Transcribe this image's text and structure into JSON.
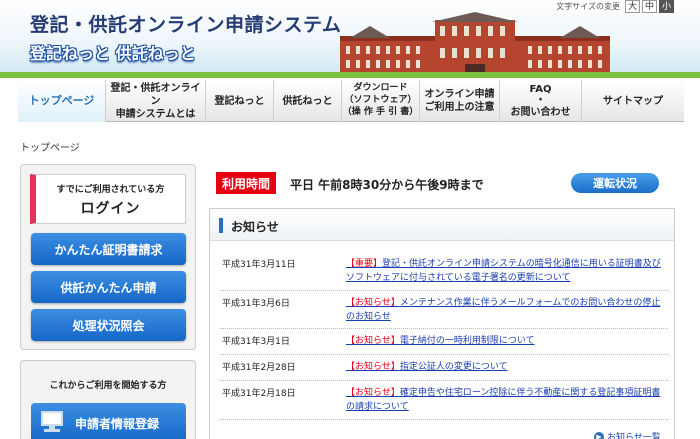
{
  "header": {
    "title": "登記・供託オンライン申請システム",
    "subtitle": "登記ねっと 供託ねっと",
    "font_size_label": "文字サイズの変更",
    "font_sizes": [
      "大",
      "中",
      "小"
    ]
  },
  "nav": {
    "items": [
      {
        "label": "トップページ",
        "width": 88
      },
      {
        "label": "登記・供託オンライン\n申請システムとは",
        "width": 100
      },
      {
        "label": "登記ねっと",
        "width": 68
      },
      {
        "label": "供託ねっと",
        "width": 68
      },
      {
        "label": "ダウンロード\n（ソフトウェア）\n（操 作 手 引 書）",
        "width": 78
      },
      {
        "label": "オンライン申請\nご利用上の注意",
        "width": 80
      },
      {
        "label": "FAQ\n・\nお問い合わせ",
        "width": 82
      },
      {
        "label": "サイトマップ",
        "width": 102
      }
    ]
  },
  "breadcrumb": "トップページ",
  "sidebar": {
    "login_sub": "すでにご利用されている方",
    "login_main": "ログイン",
    "buttons": [
      "かんたん証明書請求",
      "供託かんたん申請",
      "処理状況照会"
    ],
    "start_sub": "これからご利用を開始する方",
    "register_label": "申請者情報登録"
  },
  "hours": {
    "label": "利用時間",
    "text": "平日 午前8時30分から午後9時まで",
    "status_button": "運転状況"
  },
  "news": {
    "title": "お知らせ",
    "items": [
      {
        "date": "平成31年3月11日",
        "tag": "【重要】",
        "text": "登記・供託オンライン申請システムの暗号化通信に用いる証明書及びソフトウェアに付与されている電子署名の更新について"
      },
      {
        "date": "平成31年3月6日",
        "tag": "【お知らせ】",
        "text": "メンテナンス作業に伴うメールフォームでのお問い合わせの停止のお知らせ"
      },
      {
        "date": "平成31年3月1日",
        "tag": "【お知らせ】",
        "text": "電子納付の一時利用制限について"
      },
      {
        "date": "平成31年2月28日",
        "tag": "【お知らせ】",
        "text": "指定公証人の変更について"
      },
      {
        "date": "平成31年2月18日",
        "tag": "【お知らせ】",
        "text": "確定申告や住宅ローン控除に伴う不動産に関する登記事項証明書の請求について"
      }
    ],
    "more_label": "お知らせ一覧"
  },
  "colors": {
    "accent": "#2c71b8",
    "alert": "#e60012",
    "link": "#1a3fb0",
    "brand_pink": "#e0335b"
  }
}
